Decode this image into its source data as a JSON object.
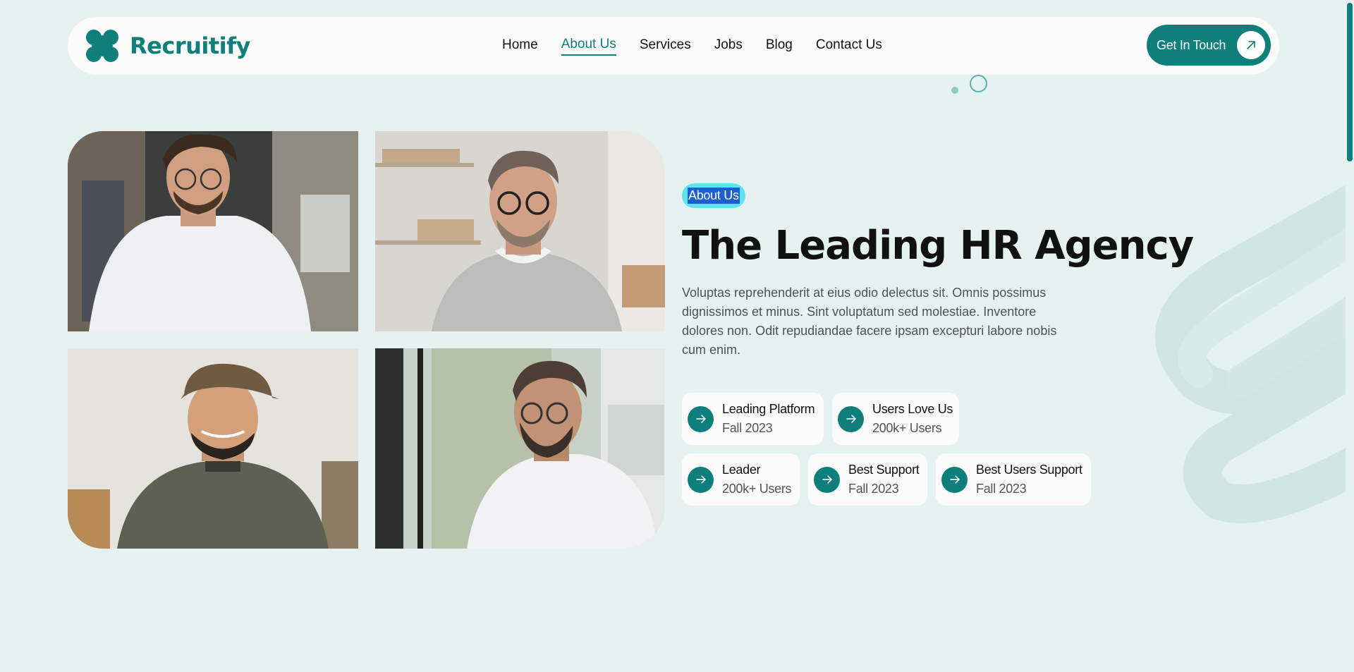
{
  "header": {
    "brand_name": "Recruitify",
    "nav": [
      {
        "label": "Home",
        "active": false
      },
      {
        "label": "About Us",
        "active": true
      },
      {
        "label": "Services",
        "active": false
      },
      {
        "label": "Jobs",
        "active": false
      },
      {
        "label": "Blog",
        "active": false
      },
      {
        "label": "Contact Us",
        "active": false
      }
    ],
    "cta_label": "Get In Touch",
    "cta_icon": "arrow-up-right-icon"
  },
  "about": {
    "badge": "About Us",
    "title": "The Leading HR Agency",
    "description": "Voluptas reprehenderit at eius odio delectus sit. Omnis possimus dignissimos et minus. Sint voluptatum sed molestiae. Inventore dolores non. Odit repudiandae facere ipsam excepturi labore nobis cum enim.",
    "stats": [
      {
        "title": "Leading Platform",
        "subtitle": "Fall 2023"
      },
      {
        "title": "Users Love Us",
        "subtitle": "200k+ Users"
      },
      {
        "title": "Leader",
        "subtitle": "200k+ Users"
      },
      {
        "title": "Best Support",
        "subtitle": "Fall 2023"
      },
      {
        "title": "Best Users Support",
        "subtitle": "Fall 2023"
      }
    ],
    "stat_icon": "arrow-right-icon"
  },
  "colors": {
    "brand": "#0f7f7b",
    "background": "#e6f2f1",
    "badge": "#5ee4ee"
  }
}
